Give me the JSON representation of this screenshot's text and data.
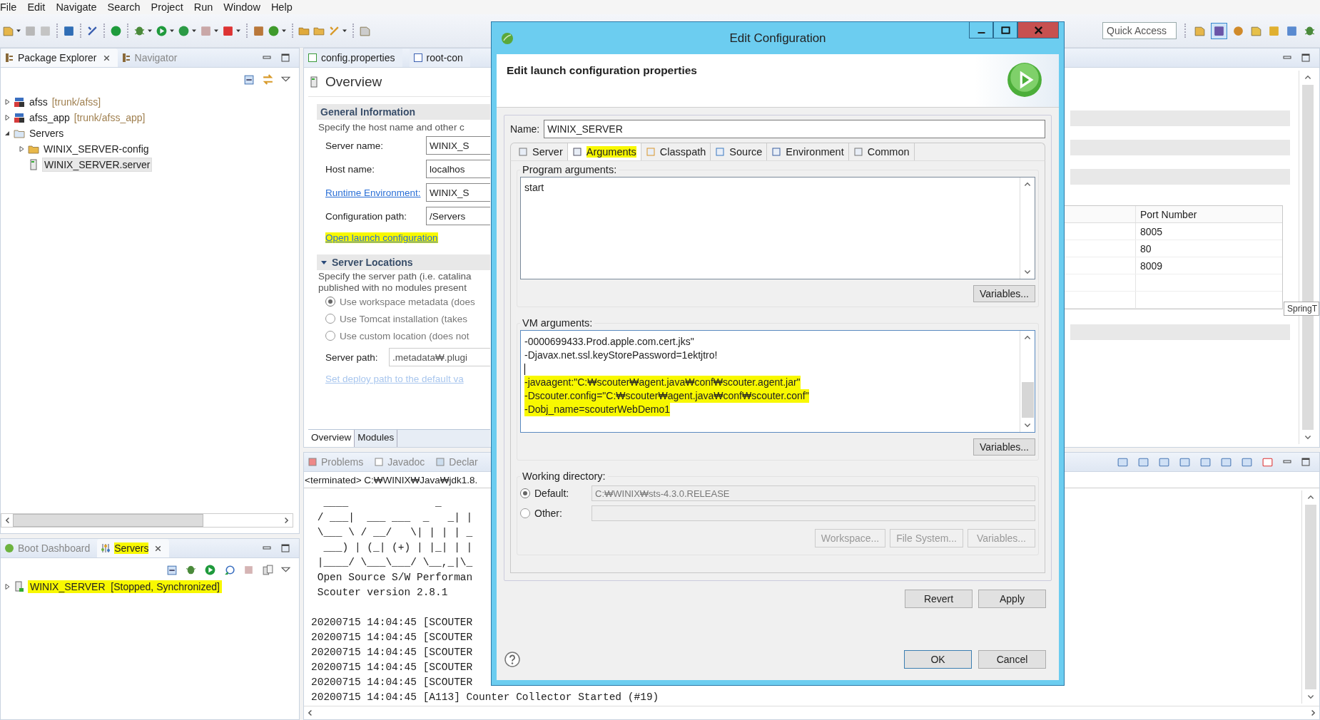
{
  "menu": [
    "File",
    "Edit",
    "Navigate",
    "Search",
    "Project",
    "Run",
    "Window",
    "Help"
  ],
  "quick_access": {
    "placeholder": "Quick Access"
  },
  "package_explorer": {
    "tabs": [
      {
        "label": "Package Explorer",
        "selected": true
      },
      {
        "label": "Navigator",
        "selected": false
      }
    ],
    "tree": [
      {
        "kind": "project",
        "label": "afss",
        "decoration": "[trunk/afss]",
        "expanded": false,
        "selected": false
      },
      {
        "kind": "project",
        "label": "afss_app",
        "decoration": "[trunk/afss_app]",
        "expanded": false,
        "selected": false
      },
      {
        "kind": "folder",
        "label": "Servers",
        "expanded": true,
        "selected": false,
        "children": [
          {
            "kind": "folder",
            "label": "WINIX_SERVER-config",
            "expanded": false,
            "selected": false
          },
          {
            "kind": "file",
            "label": "WINIX_SERVER.server",
            "selected": true
          }
        ]
      }
    ]
  },
  "servers_view": {
    "tabs": [
      {
        "label": "Boot Dashboard",
        "selected": false,
        "highlighted": false
      },
      {
        "label": "Servers",
        "selected": true,
        "highlighted": true
      }
    ],
    "servers": [
      {
        "name": "WINIX_SERVER",
        "status": "[Stopped, Synchronized]",
        "expanded": false,
        "highlighted": true
      }
    ]
  },
  "editor": {
    "tabs": [
      {
        "label": "config.properties",
        "selected": false
      },
      {
        "label": "root-con",
        "selected": false
      }
    ],
    "title": "Overview",
    "general": {
      "heading": "General Information",
      "description": "Specify the host name and other c",
      "fields": [
        {
          "kind": "text",
          "label": "Server name:",
          "value": "WINIX_S"
        },
        {
          "kind": "text",
          "label": "Host name:",
          "value": "localhos"
        },
        {
          "kind": "link",
          "label": "Runtime Environment:",
          "value": "WINIX_S"
        },
        {
          "kind": "text",
          "label": "Configuration path:",
          "value": "/Servers"
        }
      ],
      "link": {
        "label": "Open launch configuration",
        "highlighted": true
      }
    },
    "locations": {
      "heading": "Server Locations",
      "expanded": true,
      "description": [
        "Specify the server path (i.e. catalina",
        "published with no modules present"
      ],
      "disabled": true,
      "options": [
        {
          "label": "Use workspace metadata (does",
          "selected": true
        },
        {
          "label": "Use Tomcat installation (takes",
          "selected": false
        },
        {
          "label": "Use custom location (does not",
          "selected": false
        }
      ],
      "server_path": {
        "label": "Server path:",
        "value": ".metadata₩.plugi"
      },
      "deploy_link": "Set deploy path to the default va"
    },
    "page_tabs": [
      {
        "label": "Overview",
        "selected": true
      },
      {
        "label": "Modules",
        "selected": false
      }
    ],
    "ports": {
      "column": "Port Number",
      "rows": [
        "8005",
        "80",
        "8009"
      ]
    },
    "tooltip": "SpringT"
  },
  "console": {
    "tabs": [
      {
        "label": "Problems"
      },
      {
        "label": "Javadoc"
      },
      {
        "label": "Declar"
      }
    ],
    "header": "<terminated> C:₩WINIX₩Java₩jdk1.8.",
    "banner": [
      "  ____              _",
      " / ___|  ___ ___  _   _| |",
      " \\___ \\ / __/   \\| | | | _",
      "  ___) | (_| (+) | |_| | |",
      " |____/ \\___\\___/ \\__,_|\\_",
      " Open Source S/W Performan",
      " Scouter version 2.8.1"
    ],
    "log": [
      "20200715 14:04:45 [SCOUTER",
      "20200715 14:04:45 [SCOUTER",
      "20200715 14:04:45 [SCOUTER",
      "20200715 14:04:45 [SCOUTER",
      "20200715 14:04:45 [SCOUTER",
      "20200715 14:04:45 [A113] Counter Collector Started (#19)"
    ]
  },
  "dialog": {
    "title": "Edit Configuration",
    "header": "Edit launch configuration properties",
    "name_label": "Name:",
    "name_value": "WINIX_SERVER",
    "tabs": [
      {
        "label": "Server",
        "selected": false,
        "highlighted": false
      },
      {
        "label": "Arguments",
        "selected": true,
        "highlighted": true
      },
      {
        "label": "Classpath",
        "selected": false,
        "highlighted": false
      },
      {
        "label": "Source",
        "selected": false,
        "highlighted": false
      },
      {
        "label": "Environment",
        "selected": false,
        "highlighted": false
      },
      {
        "label": "Common",
        "selected": false,
        "highlighted": false
      }
    ],
    "program_args": {
      "label": "Program arguments:",
      "value": "start",
      "button": "Variables..."
    },
    "vm_args": {
      "label": "VM arguments:",
      "button": "Variables...",
      "lines": [
        {
          "kind": "text",
          "text": "-0000699433.Prod.apple.com.cert.jks\"",
          "highlighted": false
        },
        {
          "kind": "text",
          "text": "-Djavax.net.ssl.keyStorePassword=1ektjtro!",
          "highlighted": false
        },
        {
          "kind": "cursor"
        },
        {
          "kind": "text",
          "text": "-javaagent:\"C:₩scouter₩agent.java₩conf₩scouter.agent.jar\"",
          "highlighted": true
        },
        {
          "kind": "text",
          "text": "-Dscouter.config=\"C:₩scouter₩agent.java₩conf₩scouter.conf\"",
          "highlighted": true
        },
        {
          "kind": "text",
          "text": "-Dobj_name=scouterWebDemo1",
          "highlighted": true
        }
      ]
    },
    "working_dir": {
      "label": "Working directory:",
      "options": [
        {
          "label": "Default:",
          "selected": true,
          "disabled": true,
          "value": "C:₩WINIX₩sts-4.3.0.RELEASE"
        },
        {
          "label": "Other:",
          "selected": false,
          "disabled": true
        }
      ],
      "buttons": [
        {
          "label": "Workspace...",
          "disabled": true
        },
        {
          "label": "File System...",
          "disabled": true
        },
        {
          "label": "Variables...",
          "disabled": true
        }
      ]
    },
    "actions": [
      "Revert",
      "Apply"
    ],
    "footer": [
      "OK",
      "Cancel"
    ]
  }
}
